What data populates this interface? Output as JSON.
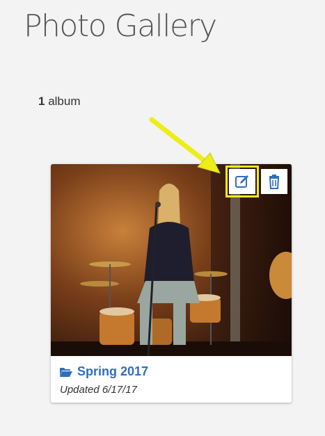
{
  "page": {
    "title": "Photo Gallery"
  },
  "gallery": {
    "album_count": "1",
    "album_count_suffix": " album"
  },
  "albums": [
    {
      "name": "Spring 2017",
      "updated": "Updated 6/17/17",
      "icon": "folder-open-icon",
      "actions": [
        {
          "name": "edit",
          "icon": "edit-icon"
        },
        {
          "name": "delete",
          "icon": "trash-icon"
        }
      ]
    }
  ],
  "colors": {
    "accent": "#2f6fbd",
    "highlight": "#f3ea1c",
    "background": "#f3f3f3"
  }
}
